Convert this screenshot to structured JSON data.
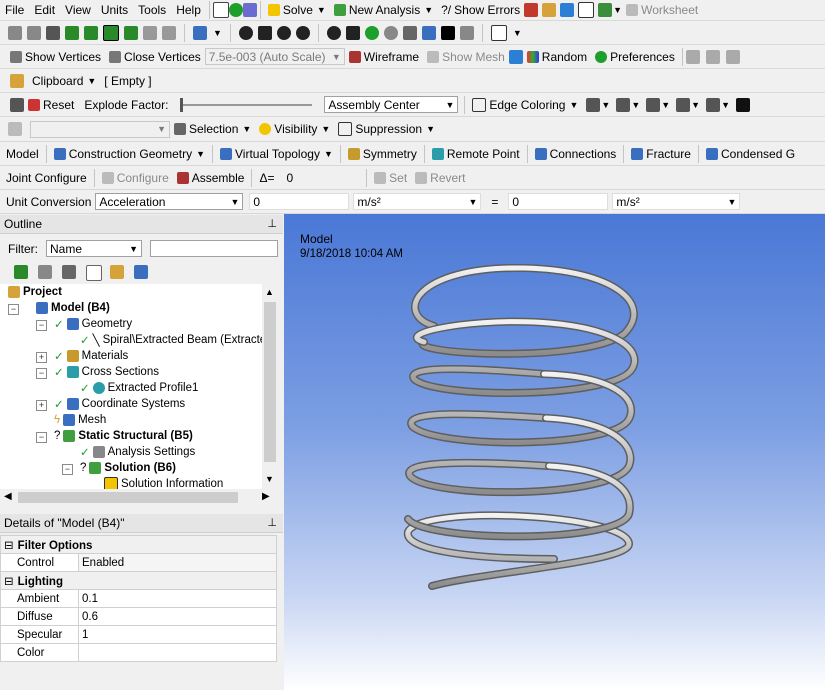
{
  "menu": [
    "File",
    "Edit",
    "View",
    "Units",
    "Tools",
    "Help"
  ],
  "toolbar1": {
    "solve": "Solve",
    "new_analysis": "New Analysis",
    "show_errors": "Show Errors",
    "worksheet": "Worksheet"
  },
  "toolbar3": {
    "show_vertices": "Show Vertices",
    "close_vertices": "Close Vertices",
    "scale": "7.5e-003 (Auto Scale)",
    "wireframe": "Wireframe",
    "show_mesh": "Show Mesh",
    "random": "Random",
    "preferences": "Preferences"
  },
  "toolbar4": {
    "clipboard": "Clipboard",
    "empty": "[ Empty ]"
  },
  "toolbar5": {
    "reset": "Reset",
    "explode": "Explode Factor:",
    "assembly": "Assembly Center",
    "edge": "Edge Coloring"
  },
  "toolbar6": {
    "selection": "Selection",
    "visibility": "Visibility",
    "suppression": "Suppression"
  },
  "context": [
    "Model",
    "Construction Geometry",
    "Virtual Topology",
    "Symmetry",
    "Remote Point",
    "Connections",
    "Fracture",
    "Condensed G"
  ],
  "joint": {
    "configure_label": "Joint Configure",
    "configure": "Configure",
    "assemble": "Assemble",
    "delta": "Δ=",
    "delta_value": "0",
    "set": "Set",
    "revert": "Revert"
  },
  "unit": {
    "label": "Unit Conversion",
    "quantity": "Acceleration",
    "value1": "0",
    "unit1": "m/s²",
    "equals": "=",
    "value2": "0",
    "unit2": "m/s²"
  },
  "outline": {
    "title": "Outline",
    "filter_label": "Filter:",
    "filter_value": "Name"
  },
  "tree": [
    {
      "label": "Project",
      "bold": true
    },
    {
      "label": "Model (B4)",
      "bold": true
    },
    {
      "label": "Geometry",
      "bold": false
    },
    {
      "label": "Spiral\\Extracted Beam (Extracte",
      "bold": false
    },
    {
      "label": "Materials",
      "bold": false
    },
    {
      "label": "Cross Sections",
      "bold": false
    },
    {
      "label": "Extracted Profile1",
      "bold": false
    },
    {
      "label": "Coordinate Systems",
      "bold": false
    },
    {
      "label": "Mesh",
      "bold": false
    },
    {
      "label": "Static Structural (B5)",
      "bold": true
    },
    {
      "label": "Analysis Settings",
      "bold": false
    },
    {
      "label": "Solution (B6)",
      "bold": true
    },
    {
      "label": "Solution Information",
      "bold": false
    }
  ],
  "details": {
    "title": "Details of \"Model (B4)\"",
    "groups": [
      {
        "name": "Filter Options",
        "rows": [
          {
            "k": "Control",
            "v": "Enabled"
          }
        ]
      },
      {
        "name": "Lighting",
        "rows": [
          {
            "k": "Ambient",
            "v": "0.1"
          },
          {
            "k": "Diffuse",
            "v": "0.6"
          },
          {
            "k": "Specular",
            "v": "1"
          },
          {
            "k": "Color",
            "v": ""
          }
        ]
      }
    ]
  },
  "viewport": {
    "title": "Model",
    "date": "9/18/2018 10:04 AM"
  }
}
